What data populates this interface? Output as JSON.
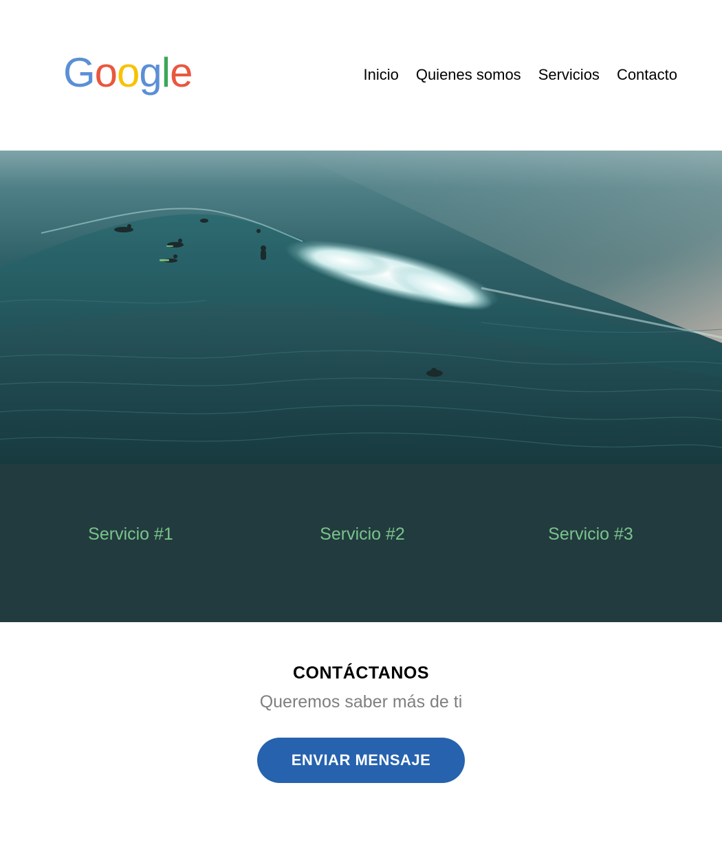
{
  "header": {
    "logo_letters": [
      {
        "char": "G",
        "color": "#5b8fd6"
      },
      {
        "char": "o",
        "color": "#e9573f"
      },
      {
        "char": "o",
        "color": "#f7c200"
      },
      {
        "char": "g",
        "color": "#5b8fd6"
      },
      {
        "char": "l",
        "color": "#3aa757"
      },
      {
        "char": "e",
        "color": "#e9573f"
      }
    ],
    "nav": [
      "Inicio",
      "Quienes somos",
      "Servicios",
      "Contacto"
    ]
  },
  "hero": {
    "image": "ocean-wave-surfers-photo"
  },
  "services": {
    "items": [
      "Servicio #1",
      "Servicio #2",
      "Servicio #3"
    ],
    "background": "#223b3e",
    "text_color": "#79c48c"
  },
  "contact": {
    "title": "CONTÁCTANOS",
    "subtitle": "Queremos saber más de ti",
    "button_label": "ENVIAR MENSAJE",
    "button_color": "#2662ae"
  }
}
